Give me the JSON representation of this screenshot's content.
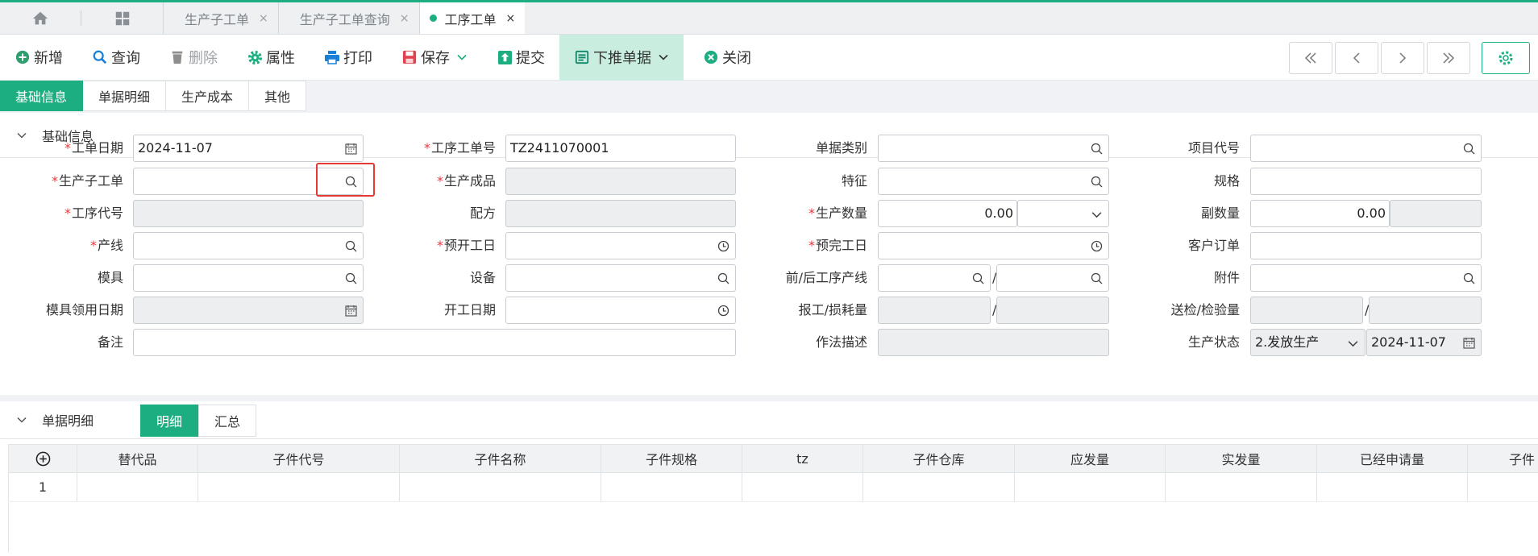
{
  "tabs": [
    {
      "label": "生产子工单",
      "close": "×"
    },
    {
      "label": "生产子工单查询",
      "close": "×"
    },
    {
      "label": "工序工单",
      "close": "×"
    }
  ],
  "toolbar": {
    "add": "新增",
    "query": "查询",
    "delete": "删除",
    "props": "属性",
    "print": "打印",
    "save": "保存",
    "submit": "提交",
    "push": "下推单据",
    "close": "关闭"
  },
  "section_tabs": [
    "基础信息",
    "单据明细",
    "生产成本",
    "其他"
  ],
  "basic": {
    "title": "基础信息",
    "work_date_label": "工单日期",
    "work_date": "2024-11-07",
    "proc_no_label": "工序工单号",
    "proc_no": "TZ2411070001",
    "doc_type_label": "单据类别",
    "project_label": "项目代号",
    "sub_order_label": "生产子工单",
    "product_label": "生产成品",
    "feature_label": "特征",
    "spec_label": "规格",
    "proc_code_label": "工序代号",
    "formula_label": "配方",
    "qty_label": "生产数量",
    "qty": "0.00",
    "sub_qty_label": "副数量",
    "sub_qty": "0.00",
    "line_label": "产线",
    "plan_start_label": "预开工日",
    "plan_end_label": "预完工日",
    "customer_order_label": "客户订单",
    "mold_label": "模具",
    "equipment_label": "设备",
    "prev_next_line_label": "前/后工序产线",
    "attachment_label": "附件",
    "mold_date_label": "模具领用日期",
    "start_date_label": "开工日期",
    "report_loss_label": "报工/损耗量",
    "inspect_label": "送检/检验量",
    "remark_label": "备注",
    "method_label": "作法描述",
    "status_label": "生产状态",
    "status_value": "2.发放生产",
    "status_date": "2024-11-07",
    "slash": "/"
  },
  "detail": {
    "title": "单据明细",
    "seg": [
      "明细",
      "汇总"
    ],
    "columns": [
      "替代品",
      "子件代号",
      "子件名称",
      "子件规格",
      "tz",
      "子件仓库",
      "应发量",
      "实发量",
      "已经申请量",
      "子件"
    ],
    "rows": [
      [
        "1"
      ]
    ]
  },
  "colors": {
    "accent": "#1cae80",
    "required": "#e8383d",
    "highlight": "#e53935"
  }
}
